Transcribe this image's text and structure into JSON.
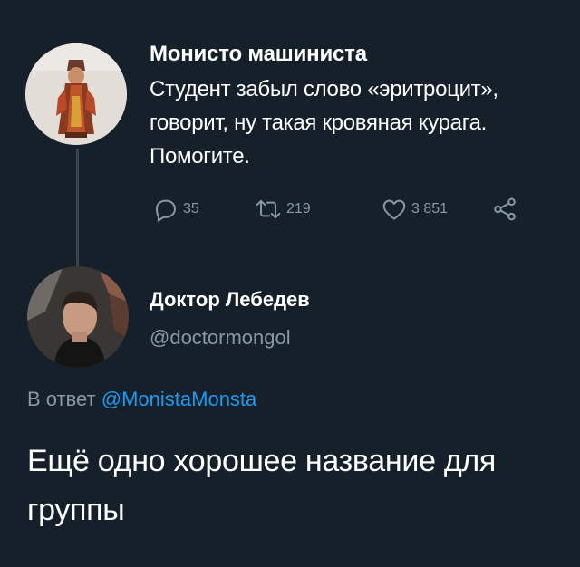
{
  "tweet1": {
    "author_name": "Монисто машиниста",
    "text": "Студент забыл слово «эритроцит», говорит, ну такая кровяная курага. Помогите.",
    "actions": {
      "replies": "35",
      "retweets": "219",
      "likes": "3 851"
    }
  },
  "tweet2": {
    "author_name": "Доктор Лебедев",
    "handle": "@doctormongol",
    "reply_prefix": "В ответ",
    "reply_mention": "@MonistaMonsta",
    "text": "Ещё одно хорошее название для группы"
  },
  "colors": {
    "background": "#15202b",
    "secondary_text": "#8899a6",
    "link": "#1d9bf0",
    "thread_line": "#38444d"
  },
  "icons": [
    "reply-icon",
    "retweet-icon",
    "like-icon",
    "share-icon"
  ]
}
